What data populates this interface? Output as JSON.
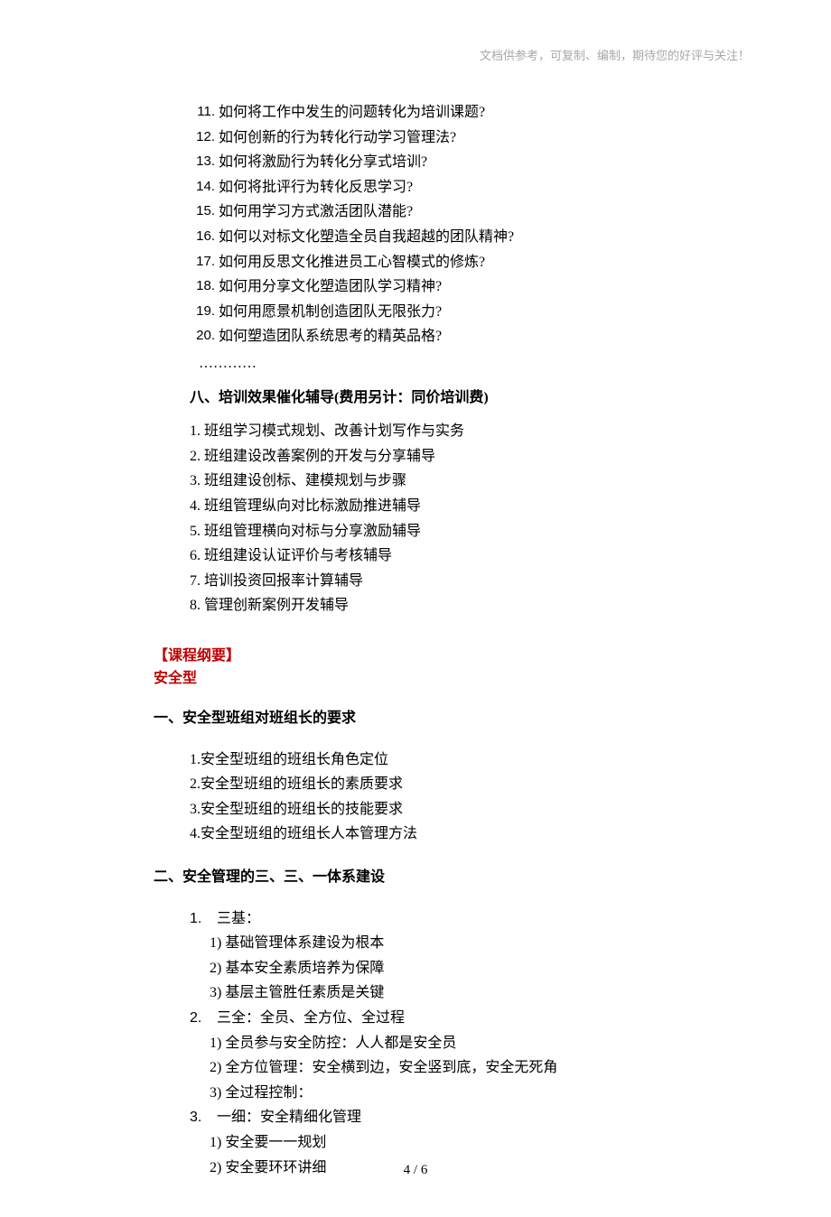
{
  "watermark": "文档供参考，可复制、编制，期待您的好评与关注！",
  "section7_items": [
    {
      "num": "11.",
      "text": "如何将工作中发生的问题转化为培训课题?"
    },
    {
      "num": "12.",
      "text": "如何创新的行为转化行动学习管理法?"
    },
    {
      "num": "13.",
      "text": "如何将激励行为转化分享式培训?"
    },
    {
      "num": "14.",
      "text": "如何将批评行为转化反思学习?"
    },
    {
      "num": "15.",
      "text": "如何用学习方式激活团队潜能?"
    },
    {
      "num": "16.",
      "text": "如何以对标文化塑造全员自我超越的团队精神?"
    },
    {
      "num": "17.",
      "text": "如何用反思文化推进员工心智模式的修炼?"
    },
    {
      "num": "18.",
      "text": "如何用分享文化塑造团队学习精神?"
    },
    {
      "num": "19.",
      "text": "如何用愿景机制创造团队无限张力?"
    },
    {
      "num": "20.",
      "text": "如何塑造团队系统思考的精英品格?"
    }
  ],
  "dots": "…………",
  "section8_heading": "八、培训效果催化辅导(费用另计：同价培训费)",
  "section8_items": [
    "1. 班组学习模式规划、改善计划写作与实务",
    "2. 班组建设改善案例的开发与分享辅导",
    "3. 班组建设创标、建模规划与步骤",
    "4. 班组管理纵向对比标激励推进辅导",
    "5. 班组管理横向对标与分享激励辅导",
    "6. 班组建设认证评价与考核辅导",
    "7. 培训投资回报率计算辅导",
    "8. 管理创新案例开发辅导"
  ],
  "outline_label": "【课程纲要】",
  "outline_sub": "安全型",
  "h1": "一、安全型班组对班组长的要求",
  "h1_items": [
    "1.安全型班组的班组长角色定位",
    "2.安全型班组的班组长的素质要求",
    "3.安全型班组的班组长的技能要求",
    "4.安全型班组的班组长人本管理方法"
  ],
  "h2": "二、安全管理的三、三、一体系建设",
  "h2_groups": [
    {
      "num": "1.",
      "title": "三基：",
      "subs": [
        "1) 基础管理体系建设为根本",
        "2) 基本安全素质培养为保障",
        "3) 基层主管胜任素质是关键"
      ]
    },
    {
      "num": "2.",
      "title": "三全：全员、全方位、全过程",
      "subs": [
        "1) 全员参与安全防控：人人都是安全员",
        "2) 全方位管理：安全横到边，安全竖到底，安全无死角",
        "3) 全过程控制："
      ]
    },
    {
      "num": "3.",
      "title": "一细：安全精细化管理",
      "subs": [
        "1) 安全要一一规划",
        "2) 安全要环环讲细"
      ]
    }
  ],
  "page_footer": "4 / 6"
}
